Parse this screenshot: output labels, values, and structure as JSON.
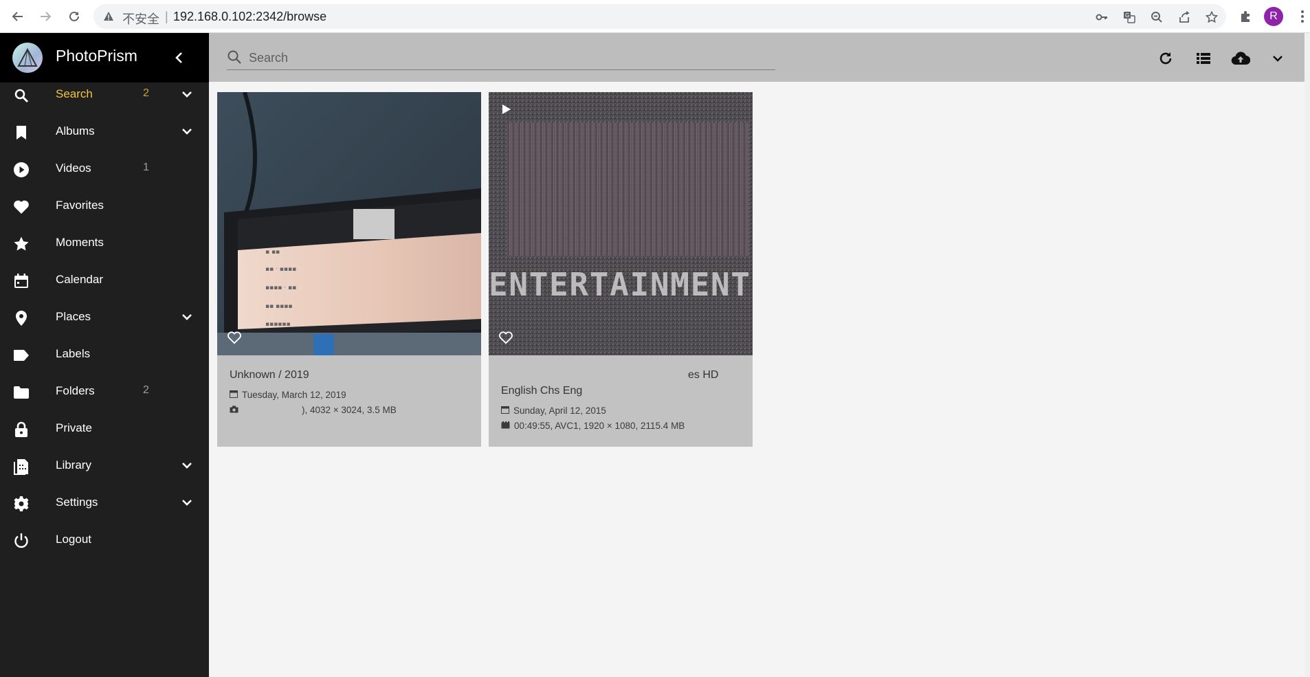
{
  "browser": {
    "security_label": "不安全",
    "separator": "|",
    "url": "192.168.0.102:2342/browse",
    "profile_initial": "R"
  },
  "sidebar": {
    "brand": "PhotoPrism",
    "items": [
      {
        "label": "Search",
        "count": "2",
        "expandable": true,
        "icon": "search-icon",
        "active": true
      },
      {
        "label": "Albums",
        "count": "",
        "expandable": true,
        "icon": "bookmark-icon"
      },
      {
        "label": "Videos",
        "count": "1",
        "expandable": false,
        "icon": "play-circle-icon"
      },
      {
        "label": "Favorites",
        "count": "",
        "expandable": false,
        "icon": "heart-icon"
      },
      {
        "label": "Moments",
        "count": "",
        "expandable": false,
        "icon": "star-icon"
      },
      {
        "label": "Calendar",
        "count": "",
        "expandable": false,
        "icon": "calendar-icon"
      },
      {
        "label": "Places",
        "count": "",
        "expandable": true,
        "icon": "location-pin-icon"
      },
      {
        "label": "Labels",
        "count": "",
        "expandable": false,
        "icon": "label-icon"
      },
      {
        "label": "Folders",
        "count": "2",
        "expandable": false,
        "icon": "folder-icon"
      },
      {
        "label": "Private",
        "count": "",
        "expandable": false,
        "icon": "lock-icon"
      },
      {
        "label": "Library",
        "count": "",
        "expandable": true,
        "icon": "library-icon"
      },
      {
        "label": "Settings",
        "count": "",
        "expandable": true,
        "icon": "gear-icon"
      },
      {
        "label": "Logout",
        "count": "",
        "expandable": false,
        "icon": "power-icon"
      }
    ]
  },
  "search": {
    "placeholder": "Search"
  },
  "cards": [
    {
      "title": "Unknown / 2019",
      "date": "Tuesday, March 12, 2019",
      "details": "), 4032 × 3024, 3.5 MB",
      "type": "photo"
    },
    {
      "title_part": "es HD",
      "title": "English Chs Eng",
      "overlay_text": "ENTERTAINMENT",
      "date": "Sunday, April 12, 2015",
      "details": "00:49:55, AVC1, 1920 × 1080, 2115.4 MB",
      "type": "video"
    }
  ],
  "colors": {
    "sidebar_bg": "#1f1f1f",
    "brand_bg": "#000000",
    "toolbar_bg": "#bdbdbd",
    "active_accent": "#f4c542",
    "card_bg": "#c2c2c2"
  }
}
